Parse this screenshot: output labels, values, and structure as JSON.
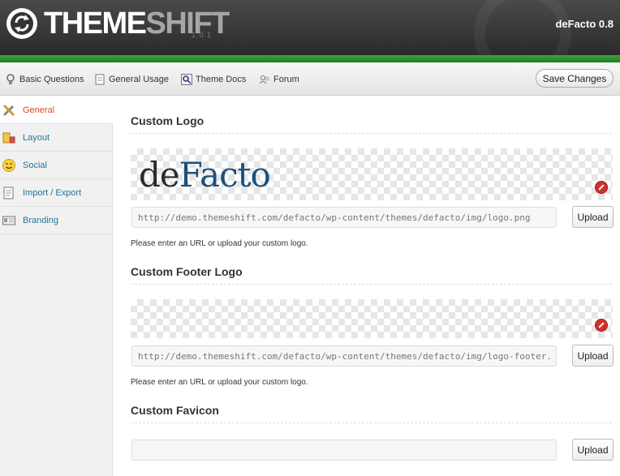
{
  "header": {
    "brand_part1": "THEME",
    "brand_part2": "SHIFT",
    "version": "1.0.1",
    "theme_name": "deFacto 0.8"
  },
  "toolbar": {
    "links": [
      {
        "label": "Basic Questions",
        "icon": "lightbulb-icon"
      },
      {
        "label": "General Usage",
        "icon": "document-icon"
      },
      {
        "label": "Theme Docs",
        "icon": "magnifier-icon"
      },
      {
        "label": "Forum",
        "icon": "users-icon"
      }
    ],
    "save_label": "Save Changes"
  },
  "sidebar": {
    "items": [
      {
        "label": "General",
        "icon": "tools-icon",
        "active": true
      },
      {
        "label": "Layout",
        "icon": "layout-icon",
        "active": false
      },
      {
        "label": "Social",
        "icon": "smiley-icon",
        "active": false
      },
      {
        "label": "Import / Export",
        "icon": "document-icon",
        "active": false
      },
      {
        "label": "Branding",
        "icon": "id-card-icon",
        "active": false
      }
    ]
  },
  "sections": {
    "logo": {
      "title": "Custom Logo",
      "preview_text_1": "de",
      "preview_text_2": "Facto",
      "url_value": "http://demo.themeshift.com/defacto/wp-content/themes/defacto/img/logo.png",
      "upload_label": "Upload",
      "hint": "Please enter an URL or upload your custom logo."
    },
    "footer_logo": {
      "title": "Custom Footer Logo",
      "url_value": "http://demo.themeshift.com/defacto/wp-content/themes/defacto/img/logo-footer.pn",
      "upload_label": "Upload",
      "hint": "Please enter an URL or upload your custom logo."
    },
    "favicon": {
      "title": "Custom Favicon",
      "url_value": "",
      "upload_label": "Upload"
    }
  },
  "colors": {
    "green_bar": "#2e912e",
    "active_sidebar": "#d54e21",
    "link": "#21759b",
    "logo_blue": "#1d4f7a"
  }
}
